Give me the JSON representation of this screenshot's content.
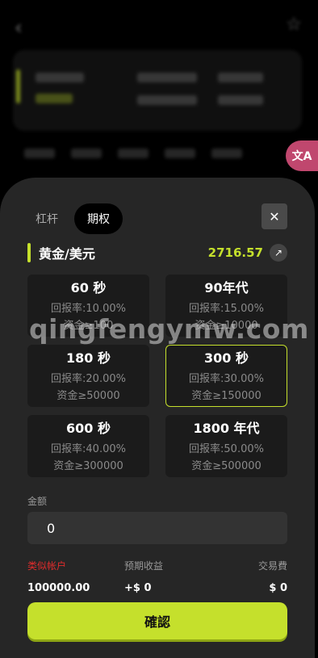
{
  "background": {
    "translate_icon": "文A"
  },
  "sheet": {
    "tabs": [
      {
        "label": "杠杆",
        "active": false
      },
      {
        "label": "期权",
        "active": true
      }
    ],
    "close_icon": "✕",
    "pair": {
      "name": "黄金/美元",
      "price": "2716.57",
      "arrow_icon": "↗"
    },
    "options": [
      {
        "title": "60 秒",
        "rate": "回报率:10.00%",
        "min": "资金≥100",
        "selected": false
      },
      {
        "title": "90年代",
        "rate": "回报率:15.00%",
        "min": "资金≥10000",
        "selected": false
      },
      {
        "title": "180 秒",
        "rate": "回报率:20.00%",
        "min": "资金≥50000",
        "selected": false
      },
      {
        "title": "300 秒",
        "rate": "回报率:30.00%",
        "min": "资金≥150000",
        "selected": true
      },
      {
        "title": "600 秒",
        "rate": "回报率:40.00%",
        "min": "资金≥300000",
        "selected": false
      },
      {
        "title": "1800 年代",
        "rate": "回报率:50.00%",
        "min": "资金≥500000",
        "selected": false
      }
    ],
    "amount_label": "金额",
    "amount_value": "0",
    "stats": {
      "account_label": "类似帐户",
      "expected_label": "预期收益",
      "fee_label": "交易費",
      "account_value": "100000.00",
      "expected_value": "+$ 0",
      "fee_value": "$ 0"
    },
    "confirm_label": "確認"
  },
  "watermark": "qingfengymw.com",
  "colors": {
    "accent": "#c5e02c",
    "account_label": "#e02c2c",
    "sheet_bg": "#262626",
    "card_bg": "#1b1b1b"
  }
}
